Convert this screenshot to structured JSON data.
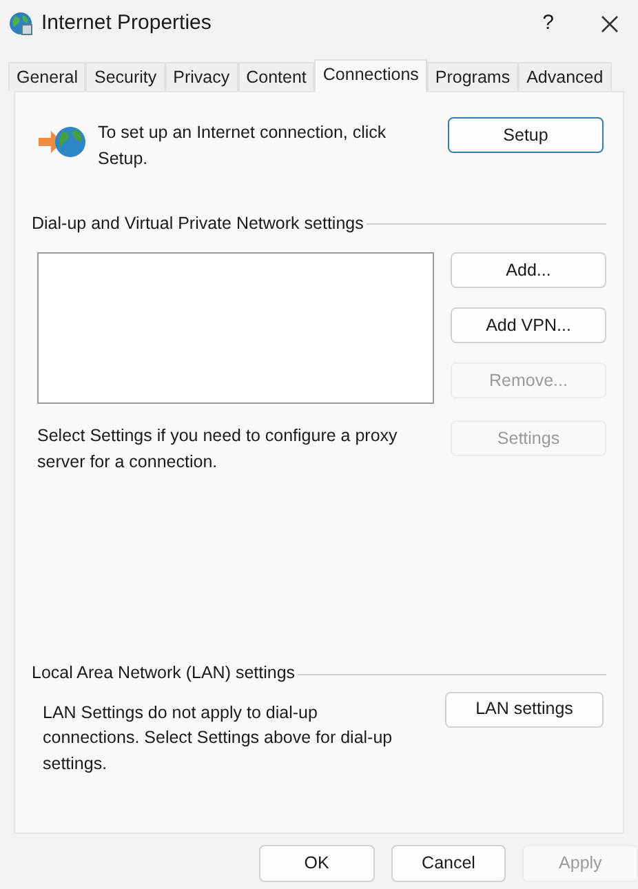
{
  "window": {
    "title": "Internet Properties",
    "help": "?"
  },
  "tabs": [
    {
      "label": "General",
      "selected": false
    },
    {
      "label": "Security",
      "selected": false
    },
    {
      "label": "Privacy",
      "selected": false
    },
    {
      "label": "Content",
      "selected": false
    },
    {
      "label": "Connections",
      "selected": true
    },
    {
      "label": "Programs",
      "selected": false
    },
    {
      "label": "Advanced",
      "selected": false
    }
  ],
  "setup": {
    "text": "To set up an Internet connection, click Setup.",
    "button": {
      "label": "Setup",
      "disabled": false
    }
  },
  "dialup": {
    "heading": "Dial-up and Virtual Private Network settings",
    "buttons": [
      {
        "label": "Add...",
        "disabled": false
      },
      {
        "label": "Add VPN...",
        "disabled": false
      },
      {
        "label": "Remove...",
        "disabled": true
      }
    ],
    "proxy_text": "Select Settings if you need to configure a proxy server for a connection.",
    "proxy_button": {
      "label": "Settings",
      "disabled": true
    }
  },
  "lan": {
    "heading": "Local Area Network (LAN) settings",
    "text": "LAN Settings do not apply to dial-up connections. Select Settings above for dial-up settings.",
    "button": {
      "label": "LAN settings",
      "disabled": false
    }
  },
  "footer_buttons": [
    {
      "label": "OK",
      "disabled": false
    },
    {
      "label": "Cancel",
      "disabled": false
    },
    {
      "label": "Apply",
      "disabled": true
    }
  ]
}
